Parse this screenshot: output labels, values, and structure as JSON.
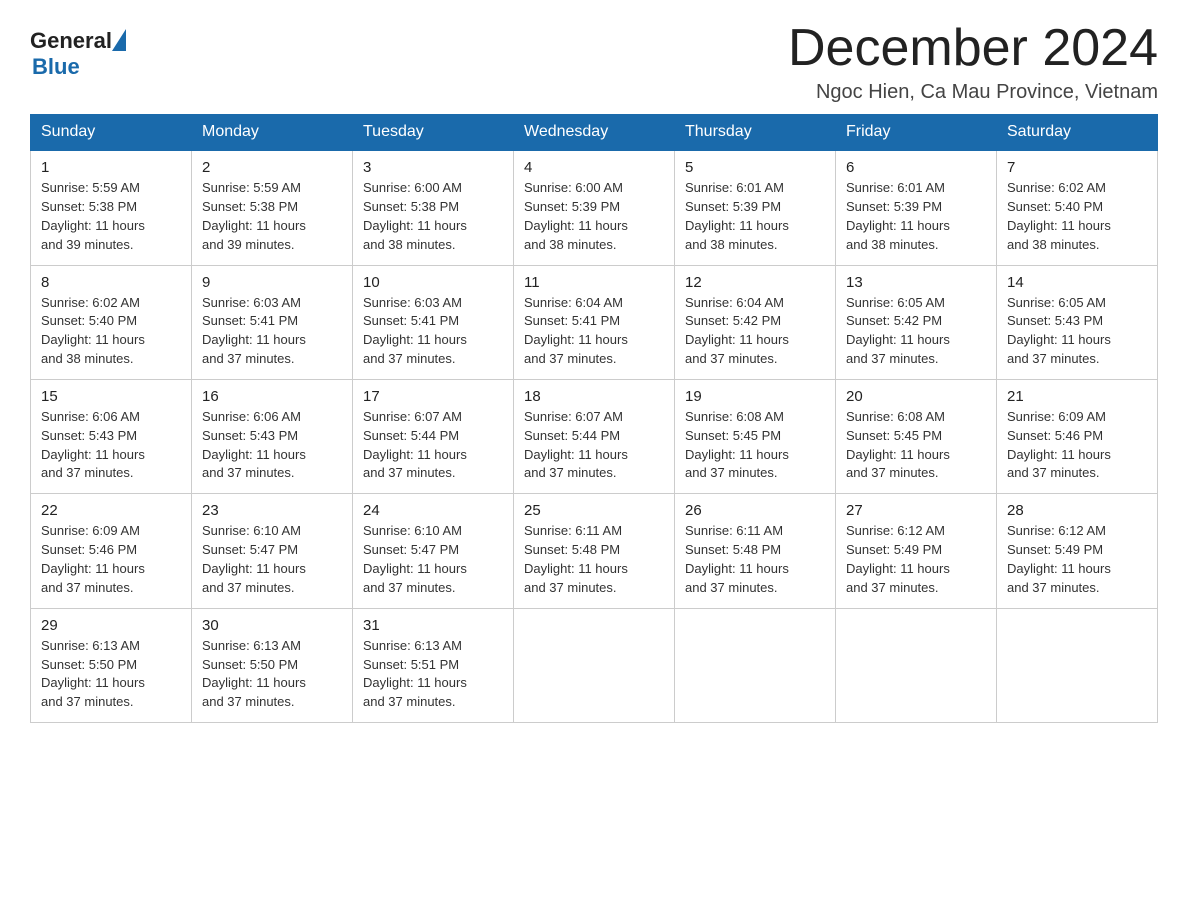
{
  "header": {
    "logo": {
      "general": "General",
      "triangle": "",
      "blue": "Blue"
    },
    "title": "December 2024",
    "location": "Ngoc Hien, Ca Mau Province, Vietnam"
  },
  "calendar": {
    "days_of_week": [
      "Sunday",
      "Monday",
      "Tuesday",
      "Wednesday",
      "Thursday",
      "Friday",
      "Saturday"
    ],
    "weeks": [
      [
        {
          "day": "1",
          "sunrise": "5:59 AM",
          "sunset": "5:38 PM",
          "daylight": "11 hours and 39 minutes."
        },
        {
          "day": "2",
          "sunrise": "5:59 AM",
          "sunset": "5:38 PM",
          "daylight": "11 hours and 39 minutes."
        },
        {
          "day": "3",
          "sunrise": "6:00 AM",
          "sunset": "5:38 PM",
          "daylight": "11 hours and 38 minutes."
        },
        {
          "day": "4",
          "sunrise": "6:00 AM",
          "sunset": "5:39 PM",
          "daylight": "11 hours and 38 minutes."
        },
        {
          "day": "5",
          "sunrise": "6:01 AM",
          "sunset": "5:39 PM",
          "daylight": "11 hours and 38 minutes."
        },
        {
          "day": "6",
          "sunrise": "6:01 AM",
          "sunset": "5:39 PM",
          "daylight": "11 hours and 38 minutes."
        },
        {
          "day": "7",
          "sunrise": "6:02 AM",
          "sunset": "5:40 PM",
          "daylight": "11 hours and 38 minutes."
        }
      ],
      [
        {
          "day": "8",
          "sunrise": "6:02 AM",
          "sunset": "5:40 PM",
          "daylight": "11 hours and 38 minutes."
        },
        {
          "day": "9",
          "sunrise": "6:03 AM",
          "sunset": "5:41 PM",
          "daylight": "11 hours and 37 minutes."
        },
        {
          "day": "10",
          "sunrise": "6:03 AM",
          "sunset": "5:41 PM",
          "daylight": "11 hours and 37 minutes."
        },
        {
          "day": "11",
          "sunrise": "6:04 AM",
          "sunset": "5:41 PM",
          "daylight": "11 hours and 37 minutes."
        },
        {
          "day": "12",
          "sunrise": "6:04 AM",
          "sunset": "5:42 PM",
          "daylight": "11 hours and 37 minutes."
        },
        {
          "day": "13",
          "sunrise": "6:05 AM",
          "sunset": "5:42 PM",
          "daylight": "11 hours and 37 minutes."
        },
        {
          "day": "14",
          "sunrise": "6:05 AM",
          "sunset": "5:43 PM",
          "daylight": "11 hours and 37 minutes."
        }
      ],
      [
        {
          "day": "15",
          "sunrise": "6:06 AM",
          "sunset": "5:43 PM",
          "daylight": "11 hours and 37 minutes."
        },
        {
          "day": "16",
          "sunrise": "6:06 AM",
          "sunset": "5:43 PM",
          "daylight": "11 hours and 37 minutes."
        },
        {
          "day": "17",
          "sunrise": "6:07 AM",
          "sunset": "5:44 PM",
          "daylight": "11 hours and 37 minutes."
        },
        {
          "day": "18",
          "sunrise": "6:07 AM",
          "sunset": "5:44 PM",
          "daylight": "11 hours and 37 minutes."
        },
        {
          "day": "19",
          "sunrise": "6:08 AM",
          "sunset": "5:45 PM",
          "daylight": "11 hours and 37 minutes."
        },
        {
          "day": "20",
          "sunrise": "6:08 AM",
          "sunset": "5:45 PM",
          "daylight": "11 hours and 37 minutes."
        },
        {
          "day": "21",
          "sunrise": "6:09 AM",
          "sunset": "5:46 PM",
          "daylight": "11 hours and 37 minutes."
        }
      ],
      [
        {
          "day": "22",
          "sunrise": "6:09 AM",
          "sunset": "5:46 PM",
          "daylight": "11 hours and 37 minutes."
        },
        {
          "day": "23",
          "sunrise": "6:10 AM",
          "sunset": "5:47 PM",
          "daylight": "11 hours and 37 minutes."
        },
        {
          "day": "24",
          "sunrise": "6:10 AM",
          "sunset": "5:47 PM",
          "daylight": "11 hours and 37 minutes."
        },
        {
          "day": "25",
          "sunrise": "6:11 AM",
          "sunset": "5:48 PM",
          "daylight": "11 hours and 37 minutes."
        },
        {
          "day": "26",
          "sunrise": "6:11 AM",
          "sunset": "5:48 PM",
          "daylight": "11 hours and 37 minutes."
        },
        {
          "day": "27",
          "sunrise": "6:12 AM",
          "sunset": "5:49 PM",
          "daylight": "11 hours and 37 minutes."
        },
        {
          "day": "28",
          "sunrise": "6:12 AM",
          "sunset": "5:49 PM",
          "daylight": "11 hours and 37 minutes."
        }
      ],
      [
        {
          "day": "29",
          "sunrise": "6:13 AM",
          "sunset": "5:50 PM",
          "daylight": "11 hours and 37 minutes."
        },
        {
          "day": "30",
          "sunrise": "6:13 AM",
          "sunset": "5:50 PM",
          "daylight": "11 hours and 37 minutes."
        },
        {
          "day": "31",
          "sunrise": "6:13 AM",
          "sunset": "5:51 PM",
          "daylight": "11 hours and 37 minutes."
        },
        null,
        null,
        null,
        null
      ]
    ],
    "labels": {
      "sunrise": "Sunrise:",
      "sunset": "Sunset:",
      "daylight": "Daylight:"
    }
  }
}
